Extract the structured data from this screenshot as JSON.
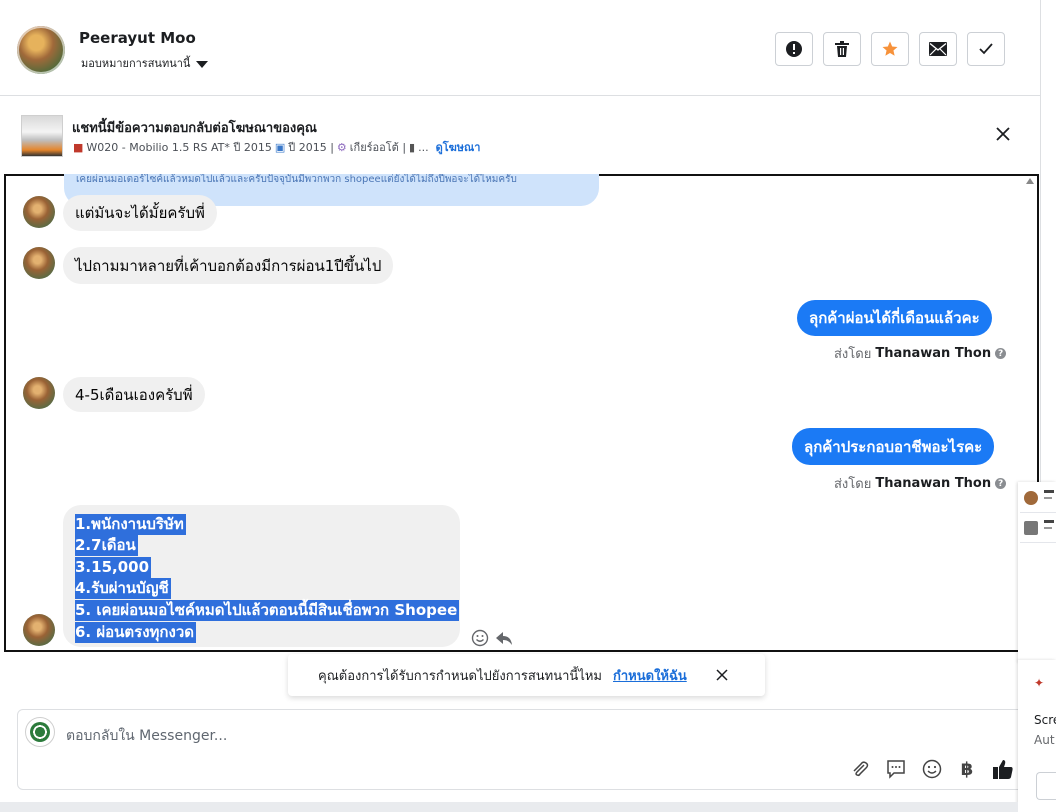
{
  "header": {
    "name": "Peerayut Moo",
    "assign_label": "มอบหมายการสนทนานี้"
  },
  "ad": {
    "title": "แชทนี้มีข้อความตอบกลับต่อโฆษณาของคุณ",
    "detail_car": "W020 - Mobilio 1.5 RS AT* ปี 2015",
    "detail_year": "ปี 2015 |",
    "detail_gear": "เกียร์ออโต้ |",
    "detail_more": "...",
    "link": "ดูโฆษณา"
  },
  "messages": {
    "cut_text": "เคยผ่อนมอเตอร์ไซค์แล้วหมดไปแล้วและครับปัจจุบันมีพวกพวก shopeeแต่ยังได้ไม่ถึงปีพอจะได้ไหมครับ",
    "m1": "แต่มันจะได้มั้ยครับพี่",
    "m2": "ไปถามมาหลายที่เค้าบอกต้องมีการผ่อน1ปีขึ้นไป",
    "m3": "ลุกค้าผ่อนได้กี่เดือนแล้วคะ",
    "m3_sent_prefix": "ส่งโดย",
    "m3_sender": "Thanawan Thon",
    "m4": "4-5เดือนเองครับพี่",
    "m5": "ลุกค้าประกอบอาชีพอะไรคะ",
    "m5_sent_prefix": "ส่งโดย",
    "m5_sender": "Thanawan Thon",
    "list": [
      "1.พนักงานบริษัท",
      "2.7เดือน",
      "3.15,000",
      "4.รับผ่านบัญชี",
      "5. เคยผ่อนมอไซค์หมดไปแล้วตอนนี้มีสินเชื่อพวก Shopee",
      "6. ผ่อนตรงทุกงวด"
    ]
  },
  "toast": {
    "text": "คุณต้องการได้รับการกำหนดไปยังการสนทนานี้ไหม",
    "link": "กำหนดให้ฉัน"
  },
  "composer": {
    "placeholder": "ตอบกลับใน Messenger..."
  },
  "right_panel": {
    "text1": "Scre",
    "text2": "Aut"
  },
  "icons": {
    "header": [
      "alert-icon",
      "trash-icon",
      "star-icon",
      "mail-icon",
      "check-icon"
    ],
    "toolbar": [
      "attachment-icon",
      "saved-reply-icon",
      "emoji-icon",
      "baht-icon",
      "thumbs-up-icon"
    ]
  },
  "colors": {
    "accent": "#1b7af5",
    "star": "#f7923a",
    "link": "#1b6ed9",
    "selection": "#2f6fdc"
  }
}
